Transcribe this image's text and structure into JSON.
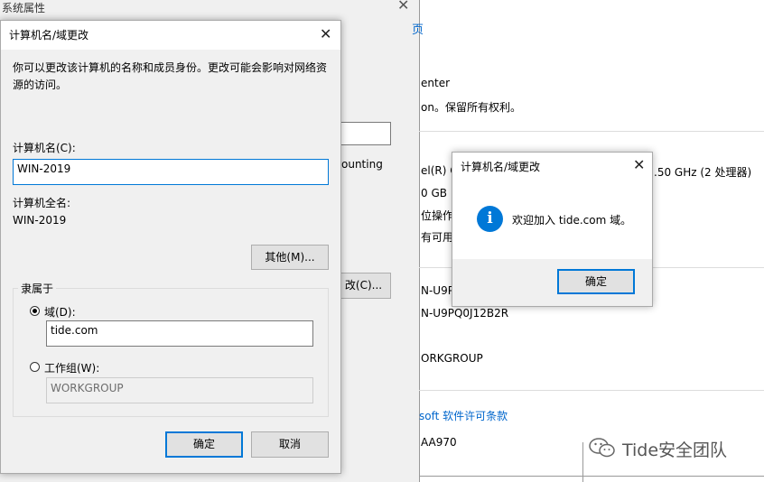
{
  "background_window": {
    "title": "系统属性",
    "fragments": {
      "link_glyph": "页",
      "l1": "enter",
      "l2": "on。保留所有权利。",
      "l3": "ounting",
      "l4": "el(R) Co",
      "l4b": ".50 GHz  (2 处理器)",
      "l5": "0 GB",
      "l6": "位操作",
      "l7": "有可用于",
      "btn_fragment": "改(C)...",
      "l8": "N-U9PQ",
      "l9": "N-U9PQ0J12B2R",
      "l10": "ORKGROUP",
      "link_license": "soft 软件许可条款",
      "l11": "AA970"
    }
  },
  "computer_name_dialog": {
    "title": "计算机名/域更改",
    "description": "你可以更改该计算机的名称和成员身份。更改可能会影响对网络资源的访问。",
    "computer_name_label": "计算机名(C):",
    "computer_name_value": "WIN-2019",
    "full_name_label": "计算机全名:",
    "full_name_value": "WIN-2019",
    "more_button": "其他(M)...",
    "member_of_label": "隶属于",
    "domain_radio_label": "域(D):",
    "domain_value": "tide.com",
    "workgroup_radio_label": "工作组(W):",
    "workgroup_value": "WORKGROUP",
    "ok_button": "确定",
    "cancel_button": "取消"
  },
  "welcome_dialog": {
    "title": "计算机名/域更改",
    "message": "欢迎加入 tide.com 域。",
    "ok_button": "确定",
    "icon": "info-icon",
    "accent": "#0078d7"
  },
  "watermark": {
    "text": "Tide安全团队",
    "icon": "wechat-icon"
  }
}
